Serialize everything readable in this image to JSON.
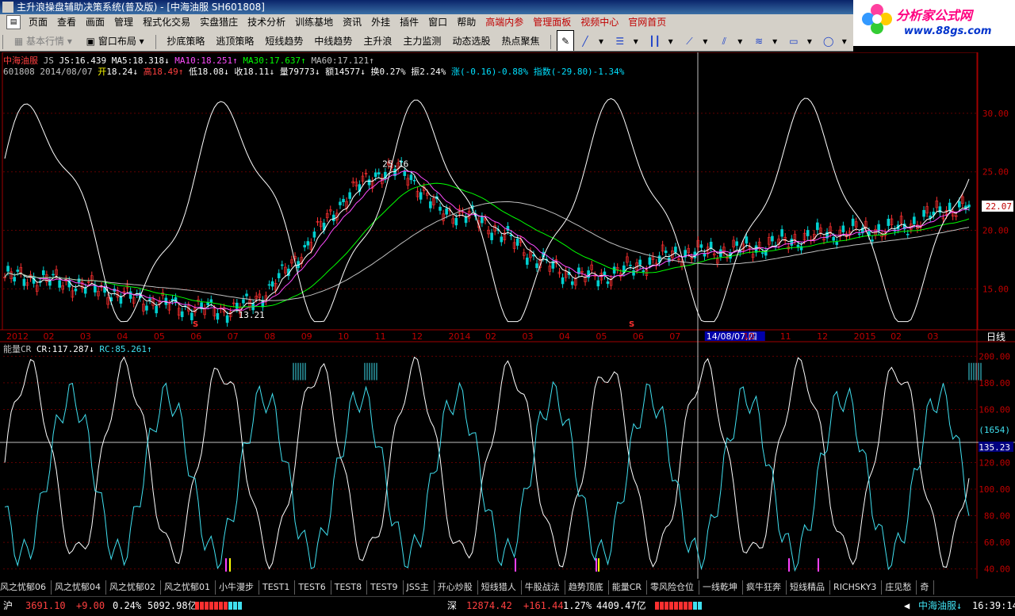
{
  "window": {
    "title": "主升浪操盘辅助决策系统(普及版) - [中海油服 SH601808]"
  },
  "menu": [
    "页面",
    "查看",
    "画面",
    "管理",
    "程式化交易",
    "实盘猎庄",
    "技术分析",
    "训练基地",
    "资讯",
    "外挂",
    "插件",
    "窗口",
    "帮助"
  ],
  "menu_red": [
    "高端内参",
    "管理面板",
    "视频中心",
    "官网首页"
  ],
  "logo": {
    "title": "分析家公式网",
    "url": "www.88gs.com"
  },
  "toolbar": {
    "basic": "基本行情",
    "window_layout": "窗口布局",
    "buttons": [
      "抄底策略",
      "逃顶策略",
      "短线趋势",
      "中线趋势",
      "主升浪",
      "主力监测",
      "动态选股",
      "热点聚焦"
    ]
  },
  "main_header": {
    "name": "中海油服",
    "indicator": "JS",
    "js": "JS:16.439",
    "ma5": "MA5:18.318↓",
    "ma10": "MA10:18.251↑",
    "ma30": "MA30:17.637↑",
    "ma60": "MA60:17.121↑"
  },
  "quote": {
    "code": "601808",
    "date": "2014/08/07",
    "open_label": "开",
    "open": "18.24↓",
    "high_label": "高",
    "high": "18.49↑",
    "low_label": "低",
    "low": "18.08↓",
    "close_label": "收",
    "close": "18.11↓",
    "vol_label": "量",
    "vol": "79773↓",
    "amt_label": "额",
    "amt": "14577↓",
    "turnover": "换0.27%",
    "amplitude": "振2.24%",
    "change": "涨(-0.16)-0.88%",
    "index": "指数(-29.80)-1.34%"
  },
  "price_axis": {
    "ticks": [
      "30.00",
      "25.00",
      "20.00",
      "15.00"
    ],
    "last_price": "22.07"
  },
  "price_annotations": {
    "high_point": "25.16",
    "low_point": "13.21"
  },
  "time_axis": {
    "labels": [
      "2012",
      "02",
      "03",
      "04",
      "05",
      "06",
      "07",
      "08",
      "09",
      "10",
      "11",
      "12",
      "2014",
      "02",
      "03",
      "04",
      "05",
      "06",
      "07",
      "14/08/07,四",
      "10",
      "11",
      "12",
      "2015",
      "02",
      "03"
    ],
    "period": "日线"
  },
  "cr_header": {
    "name": "能量CR",
    "cr": "CR:117.287↓",
    "rc": "RC:85.261↑"
  },
  "cr_axis": {
    "ticks": [
      "200.00",
      "180.00",
      "160.00",
      "120.00",
      "100.00",
      "80.00",
      "60.00",
      "40.00"
    ],
    "cursor_label": "(1654)",
    "cursor_value": "135.23"
  },
  "chart_data": {
    "type": "line",
    "price_range": [
      11.5,
      32.5
    ],
    "series": [
      {
        "name": "MA5",
        "color": "#ffffff"
      },
      {
        "name": "MA10",
        "color": "#ff4cff"
      },
      {
        "name": "MA30",
        "color": "#00ff00"
      },
      {
        "name": "MA60",
        "color": "#c0c0c0"
      },
      {
        "name": "CR",
        "color": "#ffffff"
      },
      {
        "name": "RC",
        "color": "#40e0f0"
      }
    ],
    "cr_range": [
      35,
      205
    ],
    "key_points": [
      {
        "x": "2012",
        "y": 16.0
      },
      {
        "x": "07",
        "y": 13.21
      },
      {
        "x": "11",
        "y": 25.16
      },
      {
        "x": "2014",
        "y": 21.5
      },
      {
        "x": "05",
        "y": 16.0
      },
      {
        "x": "14/08/07,四",
        "y": 18.11
      },
      {
        "x": "2015",
        "y": 20.0
      },
      {
        "x": "03",
        "y": 22.07
      }
    ]
  },
  "tabs": [
    "风之忧郁06",
    "风之忧郁04",
    "风之忧郁02",
    "风之忧郁01",
    "小牛漫步",
    "TEST1",
    "TEST6",
    "TEST8",
    "TEST9",
    "JSS主",
    "开心炒股",
    "短线猎人",
    "牛股战法",
    "趋势顶底",
    "能量CR",
    "零风险仓位",
    "一线乾坤",
    "疯牛狂奔",
    "短线精品",
    "RICHSKY3",
    "庄见愁",
    "奇"
  ],
  "status": {
    "sh_label": "沪",
    "sh_index": "3691.10",
    "sh_change": "+9.00",
    "sh_pct": "0.24%",
    "sh_amount": "5092.98亿",
    "sz_label": "深",
    "sz_index": "12874.42",
    "sz_change": "+161.44",
    "sz_pct": "1.27%",
    "sz_amount": "4409.47亿",
    "stock": "中海油服↓",
    "time": "16:39:14"
  }
}
